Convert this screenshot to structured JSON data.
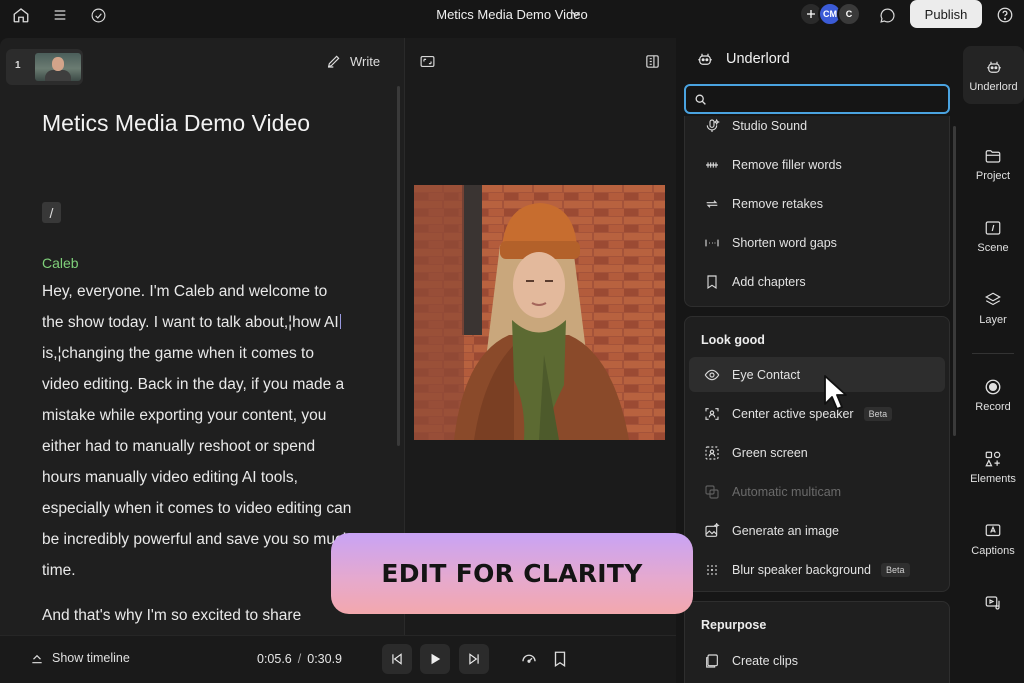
{
  "topbar": {
    "project_title": "Metics Media Demo Video",
    "collaborators": [
      "CM",
      "C"
    ],
    "publish_label": "Publish"
  },
  "script": {
    "scene_number": "1",
    "write_label": "Write",
    "doc_title": "Metics Media Demo Video",
    "slash_chip": "/",
    "speaker": "Caleb",
    "paragraph1": {
      "before_cursor": "Hey, everyone. I'm Caleb and welcome to the show today. I want to talk about,¦how AI",
      "after_cursor": "is,¦changing the game when it comes to video editing. Back in the day, if you made a mistake while exporting your content, you either had to manually reshoot or spend hours manually video editing AI tools, especially when it comes to video editing can be incredibly powerful and save you so much time."
    },
    "paragraph2": "And that's why I'm so excited to share"
  },
  "underlord": {
    "title": "Underlord",
    "search_value": "",
    "group1_items": [
      {
        "label": "Studio Sound",
        "icon": "mic-sparkle-icon"
      },
      {
        "label": "Remove filler words",
        "icon": "filler-words-icon"
      },
      {
        "label": "Remove retakes",
        "icon": "retakes-icon"
      },
      {
        "label": "Shorten word gaps",
        "icon": "word-gaps-icon"
      },
      {
        "label": "Add chapters",
        "icon": "bookmark-icon"
      }
    ],
    "group2_title": "Look good",
    "group2_items": [
      {
        "label": "Eye Contact",
        "icon": "eye-icon"
      },
      {
        "label": "Center active speaker",
        "icon": "center-speaker-icon",
        "badge": "Beta"
      },
      {
        "label": "Green screen",
        "icon": "green-screen-icon"
      },
      {
        "label": "Automatic multicam",
        "icon": "multicam-icon"
      },
      {
        "label": "Generate an image",
        "icon": "image-sparkle-icon"
      },
      {
        "label": "Blur speaker background",
        "icon": "blur-icon",
        "badge": "Beta"
      }
    ],
    "group3_title": "Repurpose",
    "group3_items": [
      {
        "label": "Create clips",
        "icon": "clips-icon"
      }
    ]
  },
  "rail": {
    "items": [
      {
        "label": "Underlord",
        "icon": "underlord-icon"
      },
      {
        "label": "Project",
        "icon": "folder-icon"
      },
      {
        "label": "Scene",
        "icon": "scene-icon"
      },
      {
        "label": "Layer",
        "icon": "layers-icon"
      },
      {
        "label": "Record",
        "icon": "record-icon"
      },
      {
        "label": "Elements",
        "icon": "elements-icon"
      },
      {
        "label": "Captions",
        "icon": "captions-icon"
      }
    ]
  },
  "transport": {
    "show_timeline_label": "Show timeline",
    "current_time": "0:05.6",
    "separator": "/",
    "total_time": "0:30.9"
  },
  "overlay": {
    "banner_text": "EDIT FOR CLARITY"
  },
  "colors": {
    "accent_focus": "#4aa3e0",
    "speaker_green": "#7fd07a",
    "banner_top": "#c8a3f5",
    "banner_bottom": "#f3a8ad"
  }
}
